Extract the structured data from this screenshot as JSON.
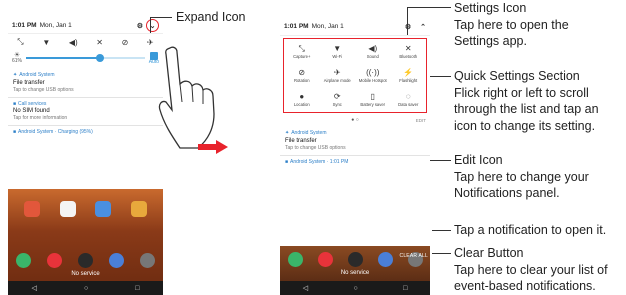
{
  "callouts": {
    "expand_icon": "Expand Icon",
    "settings_icon": {
      "title": "Settings Icon",
      "line1": "Tap here to open the",
      "line2": "Settings app."
    },
    "quick_settings": {
      "title": "Quick Settings Section",
      "line1": "Flick right or left to scroll",
      "line2": "through the list and tap an",
      "line3": "icon to change its setting."
    },
    "edit_icon": {
      "title": "Edit Icon",
      "line1": "Tap here to change your",
      "line2": "Notifications panel."
    },
    "tap_notification": "Tap a notification to open it.",
    "clear_button": {
      "title": "Clear Button",
      "line1": "Tap here to clear your list of",
      "line2": "event-based notifications."
    }
  },
  "phone1": {
    "status_time": "1:01 PM",
    "status_date": "Mon, Jan 1",
    "brightness_pct": "61%",
    "brightness_level": 0.62,
    "auto_label": "Auto",
    "notifications": [
      {
        "source": "Android System",
        "title": "File transfer",
        "sub": "Tap to change USB options"
      },
      {
        "source": "Call services",
        "title": "No SIM found",
        "sub": "Tap for more information"
      },
      {
        "source": "Android System · Charging (95%)",
        "title": "",
        "sub": ""
      }
    ]
  },
  "phone2": {
    "status_time": "1:01 PM",
    "status_date": "Mon, Jan 1",
    "tiles": [
      {
        "icon": "capture-plus-icon",
        "glyph": "⤡",
        "label": "Capture+"
      },
      {
        "icon": "wifi-icon",
        "glyph": "▼",
        "label": "Wi-Fi"
      },
      {
        "icon": "sound-icon",
        "glyph": "◀)",
        "label": "Sound"
      },
      {
        "icon": "bluetooth-icon",
        "glyph": "✕",
        "label": "Bluetooth"
      },
      {
        "icon": "rotation-icon",
        "glyph": "⊘",
        "label": "Rotation"
      },
      {
        "icon": "airplane-icon",
        "glyph": "✈",
        "label": "Airplane mode"
      },
      {
        "icon": "hotspot-icon",
        "glyph": "((·))",
        "label": "Mobile Hotspot"
      },
      {
        "icon": "flashlight-icon",
        "glyph": "⚡",
        "label": "Flashlight"
      },
      {
        "icon": "location-icon",
        "glyph": "●",
        "label": "Location"
      },
      {
        "icon": "sync-icon",
        "glyph": "⟳",
        "label": "Sync"
      },
      {
        "icon": "battery-saver-icon",
        "glyph": "▯",
        "label": "Battery saver"
      },
      {
        "icon": "data-saver-icon",
        "glyph": "◌",
        "label": "Data saver"
      }
    ],
    "edit_label": "EDIT",
    "notifications": [
      {
        "source": "Android System",
        "title": "File transfer",
        "sub": "Tap to change USB options"
      },
      {
        "source": "Android System · 1:01 PM",
        "title": "",
        "sub": ""
      }
    ],
    "clear_all": "CLEAR ALL",
    "no_service": "No service"
  },
  "phone1_no_service": "No service",
  "colors": {
    "highlight": "#e8232c",
    "accent": "#3a9ad9"
  }
}
